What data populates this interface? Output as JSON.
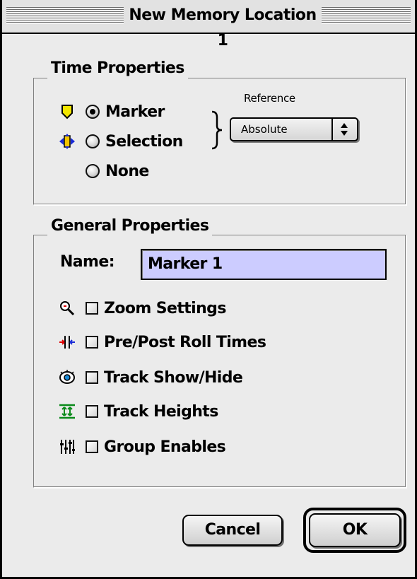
{
  "window": {
    "title": "New Memory Location 1"
  },
  "time_properties": {
    "title": "Time Properties",
    "options": [
      {
        "label": "Marker",
        "selected": true,
        "icon": "marker-icon"
      },
      {
        "label": "Selection",
        "selected": false,
        "icon": "selection-icon"
      },
      {
        "label": "None",
        "selected": false,
        "icon": ""
      }
    ],
    "reference": {
      "label": "Reference",
      "value": "Absolute"
    }
  },
  "general_properties": {
    "title": "General Properties",
    "name_label": "Name:",
    "name_value": "Marker 1",
    "name_field_color": "#ccccff",
    "checkboxes": [
      {
        "label": "Zoom Settings",
        "checked": false,
        "icon": "zoom-icon"
      },
      {
        "label": "Pre/Post Roll Times",
        "checked": false,
        "icon": "pre-post-roll-icon"
      },
      {
        "label": "Track Show/Hide",
        "checked": false,
        "icon": "track-show-hide-icon"
      },
      {
        "label": "Track Heights",
        "checked": false,
        "icon": "track-heights-icon"
      },
      {
        "label": "Group Enables",
        "checked": false,
        "icon": "group-enables-icon"
      }
    ]
  },
  "buttons": {
    "cancel": "Cancel",
    "ok": "OK"
  },
  "colors": {
    "marker_icon": "#f2e600",
    "selection_icon": "#1a2bd6",
    "window_bg": "#ebebeb"
  }
}
